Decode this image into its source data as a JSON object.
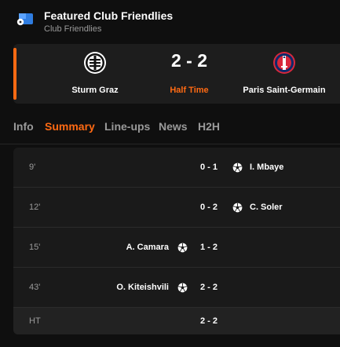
{
  "header": {
    "title": "Featured Club Friendlies",
    "subtitle": "Club Friendlies",
    "icon": "competition-flag-icon"
  },
  "match": {
    "home_team": "Sturm Graz",
    "away_team": "Paris Saint-Germain",
    "score": "2 - 2",
    "status": "Half Time",
    "home_crest_icon": "sturm-graz-crest-icon",
    "away_crest_icon": "psg-crest-icon"
  },
  "tabs": [
    {
      "label": "Info",
      "active": false
    },
    {
      "label": "Summary",
      "active": true
    },
    {
      "label": "Line-ups",
      "active": false
    },
    {
      "label": "News",
      "active": false
    },
    {
      "label": "H2H",
      "active": false
    }
  ],
  "events": [
    {
      "minute": "9'",
      "score": "0 - 1",
      "side": "away",
      "player": "I. Mbaye",
      "icon": "football-icon"
    },
    {
      "minute": "12'",
      "score": "0 - 2",
      "side": "away",
      "player": "C. Soler",
      "icon": "football-icon"
    },
    {
      "minute": "15'",
      "score": "1 - 2",
      "side": "home",
      "player": "A. Camara",
      "icon": "football-icon"
    },
    {
      "minute": "43'",
      "score": "2 - 2",
      "side": "home",
      "player": "O. Kiteishvili",
      "icon": "football-icon"
    }
  ],
  "halftime": {
    "label": "HT",
    "score": "2 - 2"
  },
  "colors": {
    "accent": "#ff6a13",
    "background": "#0f0f0f",
    "card": "#1d1d1d",
    "muted_text": "#9a9a9a"
  }
}
